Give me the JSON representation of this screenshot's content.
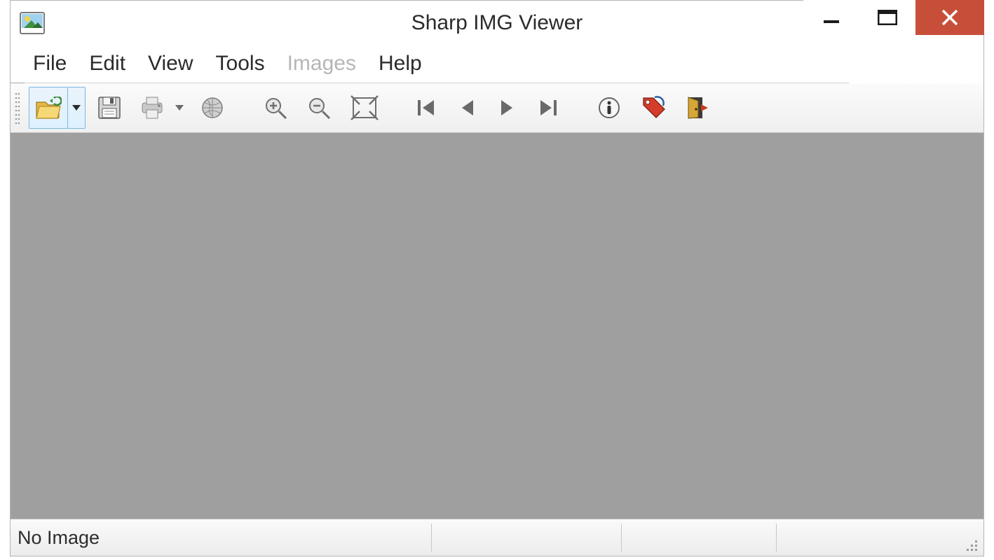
{
  "window": {
    "title": "Sharp IMG Viewer"
  },
  "menu": {
    "file": "File",
    "edit": "Edit",
    "view": "View",
    "tools": "Tools",
    "images": "Images",
    "help": "Help"
  },
  "toolbar": {
    "open": "open-icon",
    "open_recent": "open-recent-dropdown-icon",
    "save": "save-icon",
    "print": "print-icon",
    "print_split": "print-dropdown-icon",
    "web": "browser-icon",
    "zoom_in": "zoom-in-icon",
    "zoom_out": "zoom-out-icon",
    "zoom_fit": "zoom-fit-icon",
    "first": "first-image-icon",
    "prev": "previous-image-icon",
    "next": "next-image-icon",
    "last": "last-image-icon",
    "info": "image-info-icon",
    "tag": "tag-icon",
    "exit": "exit-icon"
  },
  "status": {
    "message": "No Image"
  },
  "colors": {
    "close_btn": "#c74f3a",
    "viewport_bg": "#9f9f9f",
    "highlight_border": "#7db7e3"
  }
}
